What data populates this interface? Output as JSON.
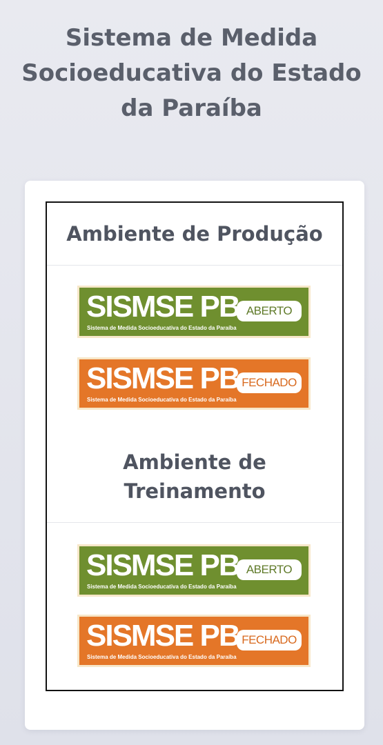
{
  "page": {
    "title": "Sistema de Medida Socioeducativa do Estado da Paraíba"
  },
  "environments": [
    {
      "title": "Ambiente de Produção",
      "buttons": [
        {
          "brand": "SISMSE PB",
          "tag": "ABERTO",
          "subtitle": "Sistema de Medida Socioeducativa do Estado da Paraíba",
          "color": "#6f8f2f"
        },
        {
          "brand": "SISMSE PB",
          "tag": "FECHADO",
          "subtitle": "Sistema de Medida Socioeducativa do Estado da Paraíba",
          "color": "#e47628"
        }
      ]
    },
    {
      "title": "Ambiente de Treinamento",
      "buttons": [
        {
          "brand": "SISMSE PB",
          "tag": "ABERTO",
          "subtitle": "Sistema de Medida Socioeducativa do Estado da Paraíba",
          "color": "#6f8f2f"
        },
        {
          "brand": "SISMSE PB",
          "tag": "FECHADO",
          "subtitle": "Sistema de Medida Socioeducativa do Estado da Paraíba",
          "color": "#e47628"
        }
      ]
    }
  ]
}
